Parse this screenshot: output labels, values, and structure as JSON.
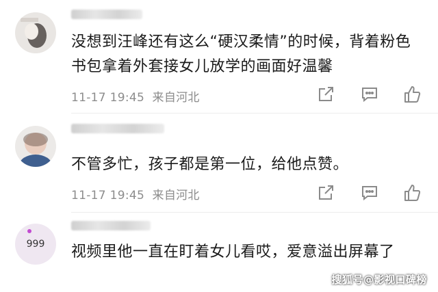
{
  "comments": [
    {
      "text": "没想到汪峰还有这么“硬汉柔情”的时候，背着粉色书包拿着外套接女儿放学的画面好温馨",
      "time": "11-17 19:45",
      "location": "来自河北"
    },
    {
      "text": "不管多忙，孩子都是第一位，给他点赞。",
      "time": "11-17 19:45",
      "location": "来自河北"
    },
    {
      "text": "视频里他一直在盯着女儿看哎，爱意溢出屏幕了",
      "avatar_label": "999"
    }
  ],
  "icons": {
    "share": "share-icon",
    "reply": "comment-icon",
    "like": "thumbs-up-icon"
  },
  "watermark": "搜狐号@影视口碑榜"
}
